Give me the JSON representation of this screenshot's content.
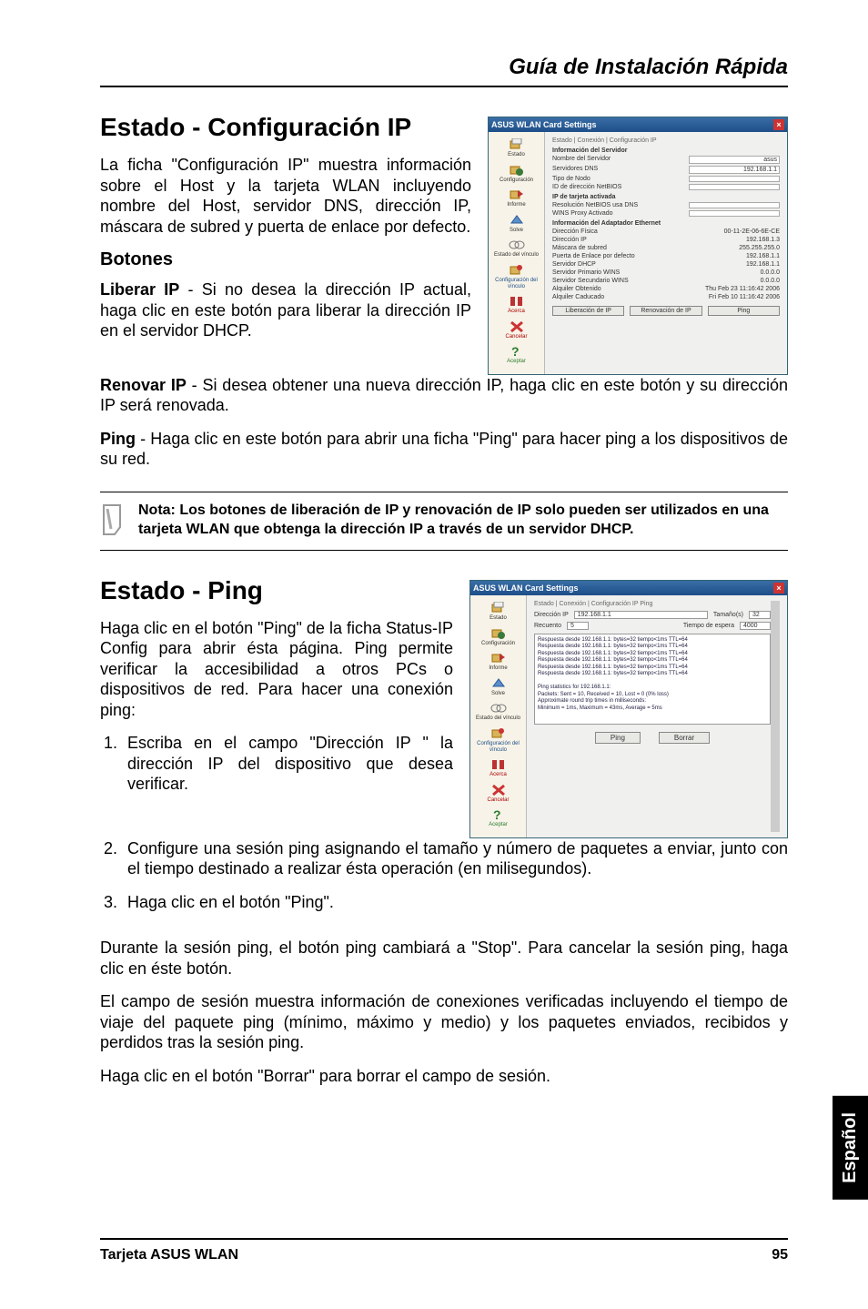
{
  "doc": {
    "header": "Guía de Instalación Rápida",
    "h1": "Estado - Configuración IP",
    "p1": "La ficha \"Configuración IP\" muestra información sobre el Host y la tarjeta WLAN incluyendo nombre del Host, servidor DNS, dirección IP, máscara de subred y puerta de enlace por defecto.",
    "sub1": "Botones",
    "p2a": "Liberar IP",
    "p2b": " - Si no desea la dirección IP actual, haga clic en este botón para liberar la dirección IP en el servidor DHCP.",
    "p3a": "Renovar IP",
    "p3b": " - Si desea obtener una nueva dirección IP, haga clic en este botón y su dirección IP será renovada.",
    "p4a": "Ping",
    "p4b": " - Haga clic en este botón para abrir una ficha \"Ping\" para hacer ping a los dispositivos de su red.",
    "note": "Nota: Los botones de liberación de IP y renovación de IP solo pueden ser utilizados en una tarjeta WLAN que obtenga la dirección IP a través de un servidor DHCP.",
    "h2": "Estado - Ping",
    "p5": "Haga clic en el botón \"Ping\" de la ficha Status-IP Config para abrir ésta página. Ping permite verificar la accesibilidad a otros PCs o dispositivos de red. Para hacer una conexión ping:",
    "s1": "Escriba en el campo \"Dirección IP \" la dirección IP del dispositivo que desea verificar.",
    "s2": "Configure una sesión ping asignando el tamaño y número de paquetes a enviar, junto con el tiempo destinado a realizar ésta operación (en milisegundos).",
    "s3": "Haga clic en el botón \"Ping\".",
    "p6": "Durante la sesión ping, el botón ping cambiará a \"Stop\". Para cancelar la sesión ping, haga clic en éste botón.",
    "p7": "El campo de sesión muestra información de conexiones verificadas incluyendo el tiempo de viaje del paquete ping (mínimo, máximo y medio) y los paquetes enviados, recibidos y perdidos tras la sesión ping.",
    "p8": "Haga clic en el botón \"Borrar\" para borrar el campo de sesión.",
    "tab": "Español",
    "footer_l": "Tarjeta ASUS WLAN",
    "footer_r": "95"
  },
  "shot1": {
    "title": "ASUS WLAN Card Settings",
    "tabs": "Estado | Conexión | Configuración IP",
    "side": [
      "Estado",
      "Configuración",
      "Informe",
      "Solve",
      "Estado del vínculo",
      "Configuración del vínculo",
      "Acerca",
      "Cancelar",
      "Aceptar"
    ],
    "sect1": "Información del Servidor",
    "f1l": "Nombre del Servidor",
    "f1v": "asus",
    "f2l": "Servidores DNS",
    "f2v": "192.168.1.1",
    "f3l": "Tipo de Nodo",
    "f4l": "ID de dirección NetBIOS",
    "sect2": "IP de tarjeta activada",
    "f5l": "Resolución NetBIOS usa DNS",
    "f6l": "WINS Proxy Activado",
    "sect3": "Información del Adaptador Ethernet",
    "f7l": "Dirección Física",
    "f7v": "00-11-2E-06-6E-CE",
    "f8l": "Dirección IP",
    "f8v": "192.168.1.3",
    "f9l": "Máscara de subred",
    "f9v": "255.255.255.0",
    "f10l": "Puerta de Enlace por defecto",
    "f10v": "192.168.1.1",
    "f11l": "Servidor DHCP",
    "f11v": "192.168.1.1",
    "f12l": "Servidor Primario WINS",
    "f12v": "0.0.0.0",
    "f13l": "Servidor Secundario WINS",
    "f13v": "0.0.0.0",
    "f14l": "Alquiler Obtenido",
    "f14v": "Thu Feb 23 11:16:42 2006",
    "f15l": "Alquiler Caducado",
    "f15v": "Fri Feb 10 11:16:42 2006",
    "b1": "Liberación de IP",
    "b2": "Renovación de IP",
    "b3": "Ping"
  },
  "shot2": {
    "title": "ASUS WLAN Card Settings",
    "tabs": "Estado | Conexión | Configuración IP  Ping",
    "side": [
      "Estado",
      "Configuración",
      "Informe",
      "Solve",
      "Estado del vínculo",
      "Configuración del vínculo",
      "Acerca",
      "Cancelar",
      "Aceptar"
    ],
    "l1": "Dirección IP",
    "v1": "192.168.1.1",
    "l2": "Tamaño(s)",
    "v2": "32",
    "l3": "Recuento",
    "v3": "5",
    "l4": "Tiempo de espera",
    "v4": "4000",
    "log": "Respuesta desde 192.168.1.1: bytes=32 tiempo<1ms TTL=64\nRespuesta desde 192.168.1.1: bytes=32 tiempo<1ms TTL=64\nRespuesta desde 192.168.1.1: bytes=32 tiempo<1ms TTL=64\nRespuesta desde 192.168.1.1: bytes=32 tiempo<1ms TTL=64\nRespuesta desde 192.168.1.1: bytes=32 tiempo<1ms TTL=64\nRespuesta desde 192.168.1.1: bytes=32 tiempo<1ms TTL=64\n\nPing statistics for 192.168.1.1:\n    Packets: Sent = 10, Received = 10, Lost = 0 (0% loss)\nApproximate round trip times in milliseconds:\n    Minimum = 1ms, Maximum = 43ms, Average = 5ms",
    "b1": "Ping",
    "b2": "Borrar"
  }
}
